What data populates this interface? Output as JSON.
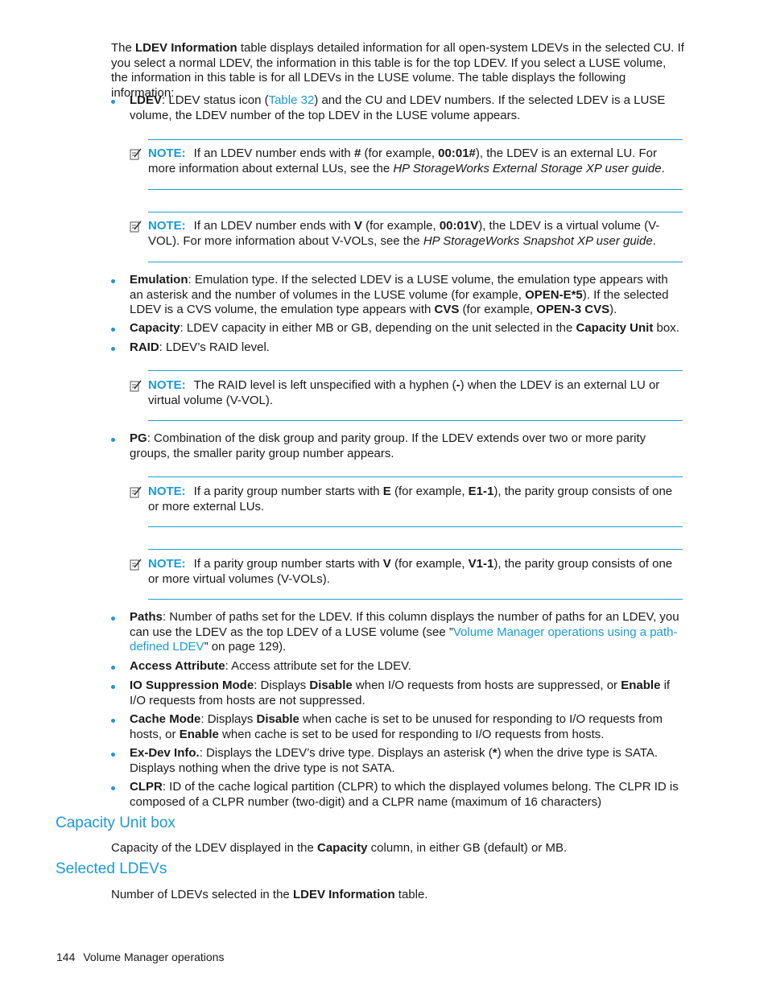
{
  "intro": {
    "pre": "The ",
    "bold": "LDEV Information",
    "post": " table displays detailed information for all open-system LDEVs in the selected CU. If you select a normal LDEV, the information in this table is for the top LDEV. If you select a LUSE volume, the information in this table is for all LDEVs in the LUSE volume. The table displays the following information:"
  },
  "bullets": {
    "ldev": {
      "term": "LDEV",
      "pre": ": LDEV status icon (",
      "link": "Table 32",
      "post": ") and the CU and LDEV numbers. If the selected LDEV is a LUSE volume, the LDEV number of the top LDEV in the LUSE volume appears."
    },
    "emulation": {
      "term": "Emulation",
      "t1": ": Emulation type. If the selected LDEV is a LUSE volume, the emulation type appears with an asterisk and the number of volumes in the LUSE volume (for example, ",
      "b1": "OPEN-E*5",
      "t2": "). If the selected LDEV is a CVS volume, the emulation type appears with ",
      "b2": "CVS",
      "t3": " (for example, ",
      "b3": "OPEN-3 CVS",
      "t4": ")."
    },
    "capacity": {
      "term": "Capacity",
      "t1": ": LDEV capacity in either MB or GB, depending on the unit selected in the ",
      "b1": "Capacity Unit",
      "t2": " box."
    },
    "raid": {
      "term": "RAID",
      "t1": ": LDEV’s RAID level."
    },
    "pg": {
      "term": "PG",
      "t1": ": Combination of the disk group and parity group. If the LDEV extends over two or more parity groups, the smaller parity group number appears."
    },
    "paths": {
      "term": "Paths",
      "t1": ": Number of paths set for the LDEV. If this column displays the number of paths for an LDEV, you can use the LDEV as the top LDEV of a LUSE volume (see ”",
      "link": "Volume Manager operations using a path-defined LDEV",
      "t2": "” on page 129)."
    },
    "access": {
      "term": "Access Attribute",
      "t1": ": Access attribute set for the LDEV."
    },
    "io": {
      "term": "IO Suppression Mode",
      "t1": ": Displays ",
      "b1": "Disable",
      "t2": " when I/O requests from hosts are suppressed, or ",
      "b2": "Enable",
      "t3": " if I/O requests from hosts are not suppressed."
    },
    "cache": {
      "term": "Cache Mode",
      "t1": ": Displays ",
      "b1": "Disable",
      "t2": " when cache is set to be unused for responding to I/O requests from hosts, or ",
      "b2": "Enable",
      "t3": " when cache is set to be used for responding to I/O requests from hosts."
    },
    "exdev": {
      "term": "Ex-Dev Info.",
      "t1": ": Displays the LDEV’s drive type. Displays an asterisk (",
      "b1": "*",
      "t2": ") when the drive type is SATA. Displays nothing when the drive type is not SATA."
    },
    "clpr": {
      "term": "CLPR",
      "t1": ": ID of the cache logical partition (CLPR) to which the displayed volumes belong. The CLPR ID is composed of a CLPR number (two-digit) and a CLPR name (maximum of 16 characters)"
    }
  },
  "notes": {
    "label": "NOTE:",
    "icon": "note-pencil-icon",
    "n1": {
      "t1": "If an LDEV number ends with ",
      "b1": "#",
      "t2": " (for example, ",
      "b2": "00:01#",
      "t3": "), the LDEV is an external LU. For more information about external LUs, see the ",
      "i1": "HP StorageWorks External Storage XP user guide",
      "t4": "."
    },
    "n2": {
      "t1": "If an LDEV number ends with ",
      "b1": "V",
      "t2": " (for example, ",
      "b2": "00:01V",
      "t3": "), the LDEV is a virtual volume (V-VOL). For more information about V-VOLs, see the ",
      "i1": "HP StorageWorks Snapshot XP user guide",
      "t4": "."
    },
    "n3": {
      "t1": "The RAID level is left unspecified with a hyphen (",
      "b1": "-",
      "t2": ") when the LDEV is an external LU or virtual volume (V-VOL)."
    },
    "n4": {
      "t1": "If a parity group number starts with ",
      "b1": "E",
      "t2": " (for example, ",
      "b2": "E1-1",
      "t3": "), the parity group consists of one or more external LUs."
    },
    "n5": {
      "t1": "If a parity group number starts with ",
      "b1": "V",
      "t2": " (for example, ",
      "b2": "V1-1",
      "t3": "), the parity group consists of one or more virtual volumes (V-VOLs)."
    }
  },
  "sections": {
    "capacity_unit": {
      "heading": "Capacity Unit box",
      "t1": "Capacity of the LDEV displayed in the ",
      "b1": "Capacity",
      "t2": " column, in either GB (default) or MB."
    },
    "selected": {
      "heading": "Selected LDEVs",
      "t1": "Number of LDEVs selected in the ",
      "b1": "LDEV Information",
      "t2": " table."
    }
  },
  "footer": {
    "page": "144",
    "title": "Volume Manager operations"
  },
  "colors": {
    "accent": "#1a9ad6",
    "rule": "#1c9fcf",
    "text": "#1a1a1a"
  }
}
